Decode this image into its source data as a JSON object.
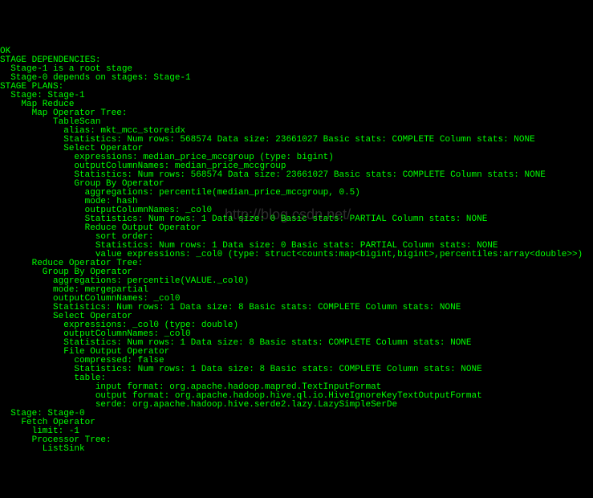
{
  "watermark": "http://blog.csdn.net/",
  "lines": [
    "OK",
    "STAGE DEPENDENCIES:",
    "  Stage-1 is a root stage",
    "  Stage-0 depends on stages: Stage-1",
    "",
    "STAGE PLANS:",
    "  Stage: Stage-1",
    "    Map Reduce",
    "      Map Operator Tree:",
    "          TableScan",
    "            alias: mkt_mcc_storeidx",
    "            Statistics: Num rows: 568574 Data size: 23661027 Basic stats: COMPLETE Column stats: NONE",
    "            Select Operator",
    "              expressions: median_price_mccgroup (type: bigint)",
    "              outputColumnNames: median_price_mccgroup",
    "              Statistics: Num rows: 568574 Data size: 23661027 Basic stats: COMPLETE Column stats: NONE",
    "              Group By Operator",
    "                aggregations: percentile(median_price_mccgroup, 0.5)",
    "                mode: hash",
    "                outputColumnNames: _col0",
    "                Statistics: Num rows: 1 Data size: 0 Basic stats: PARTIAL Column stats: NONE",
    "                Reduce Output Operator",
    "                  sort order:",
    "                  Statistics: Num rows: 1 Data size: 0 Basic stats: PARTIAL Column stats: NONE",
    "                  value expressions: _col0 (type: struct<counts:map<bigint,bigint>,percentiles:array<double>>)",
    "      Reduce Operator Tree:",
    "        Group By Operator",
    "          aggregations: percentile(VALUE._col0)",
    "          mode: mergepartial",
    "          outputColumnNames: _col0",
    "          Statistics: Num rows: 1 Data size: 8 Basic stats: COMPLETE Column stats: NONE",
    "          Select Operator",
    "            expressions: _col0 (type: double)",
    "            outputColumnNames: _col0",
    "            Statistics: Num rows: 1 Data size: 8 Basic stats: COMPLETE Column stats: NONE",
    "            File Output Operator",
    "              compressed: false",
    "              Statistics: Num rows: 1 Data size: 8 Basic stats: COMPLETE Column stats: NONE",
    "              table:",
    "                  input format: org.apache.hadoop.mapred.TextInputFormat",
    "                  output format: org.apache.hadoop.hive.ql.io.HiveIgnoreKeyTextOutputFormat",
    "                  serde: org.apache.hadoop.hive.serde2.lazy.LazySimpleSerDe",
    "",
    "  Stage: Stage-0",
    "    Fetch Operator",
    "      limit: -1",
    "      Processor Tree:",
    "        ListSink"
  ]
}
